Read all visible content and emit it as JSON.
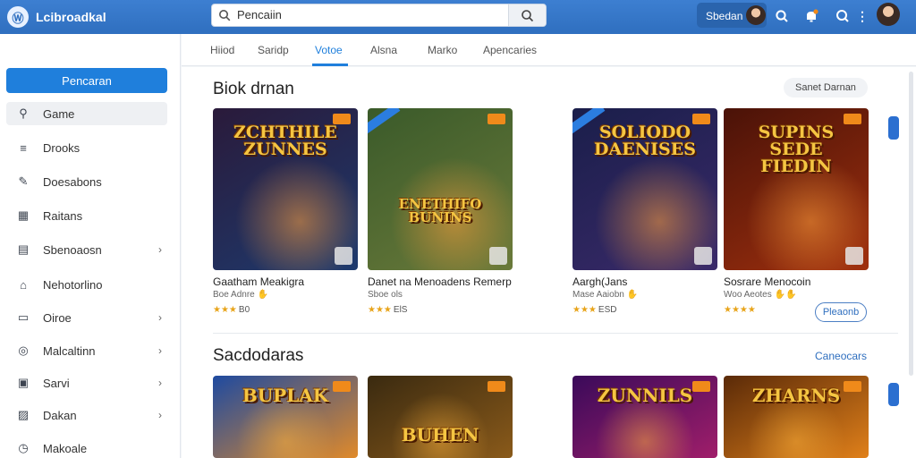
{
  "app": {
    "brand": "Lcibroadkal",
    "logo_glyph": "Ⓦ"
  },
  "search": {
    "value": "Pencaiin"
  },
  "header": {
    "user_label": "Sbedan"
  },
  "sidebar": {
    "primary_button": "Pencaran",
    "items": [
      {
        "label": "Game",
        "icon": "search-icon",
        "glyph": "⚲",
        "chevron": false,
        "active": true
      },
      {
        "label": "Drooks",
        "icon": "stack-icon",
        "glyph": "≡",
        "chevron": false,
        "active": false
      },
      {
        "label": "Doesabons",
        "icon": "pen-icon",
        "glyph": "✎",
        "chevron": false,
        "active": false
      },
      {
        "label": "Raitans",
        "icon": "calendar-icon",
        "glyph": "▦",
        "chevron": false,
        "active": false
      },
      {
        "label": "Sbenoaosn",
        "icon": "grid-icon",
        "glyph": "▤",
        "chevron": true,
        "active": false
      },
      {
        "label": "Nehotorlino",
        "icon": "home-icon",
        "glyph": "⌂",
        "chevron": false,
        "active": false
      },
      {
        "label": "Oiroe",
        "icon": "briefcase-icon",
        "glyph": "▭",
        "chevron": true,
        "active": false
      },
      {
        "label": "Malcaltinn",
        "icon": "globe-icon",
        "glyph": "◎",
        "chevron": true,
        "active": false
      },
      {
        "label": "Sarvi",
        "icon": "tablet-icon",
        "glyph": "▣",
        "chevron": true,
        "active": false
      },
      {
        "label": "Dakan",
        "icon": "image-icon",
        "glyph": "▨",
        "chevron": true,
        "active": false
      },
      {
        "label": "Makoale",
        "icon": "clock-icon",
        "glyph": "◷",
        "chevron": false,
        "active": false
      }
    ]
  },
  "tabs": [
    "Hiiod",
    "Saridp",
    "Votoe",
    "Alsna",
    "Marko",
    "Apencaries"
  ],
  "active_tab": "Votoe",
  "section1": {
    "title": "Biok drnan",
    "action": "Sanet Darnan",
    "cards": [
      {
        "art_title": "ZCHTHILE ZUNNES",
        "title": "Gaatham Meakigra",
        "subtitle": "Boe Adnre ✋",
        "stars": "★★★",
        "count": "B0",
        "colors": [
          "#2a1a3a",
          "#1e3a6e"
        ]
      },
      {
        "art_title": "ENETHIFO BUNINS",
        "title": "Danet na Menoadens Remerp",
        "subtitle": "Sboe ols",
        "stars": "★★★",
        "count": "ElS",
        "colors": [
          "#3a5a2a",
          "#6a7a3a"
        ]
      },
      {
        "art_title": "SOLIODO DAENISES",
        "title": "Aargh(Jans",
        "subtitle": "Mase Aaiobn ✋",
        "stars": "★★★",
        "count": "ESD",
        "colors": [
          "#1a1e4a",
          "#3a2a6a"
        ]
      },
      {
        "art_title": "SUPINS SEDE FIEDIN",
        "title": "Sosrare Menocoin",
        "subtitle": "Woo Aeotes ✋✋",
        "stars": "★★★★",
        "count": "",
        "colors": [
          "#4a1208",
          "#a0300e"
        ]
      }
    ],
    "card_button": "Pleaonb"
  },
  "section2": {
    "title": "Sacdodaras",
    "action": "Caneocars",
    "cards": [
      {
        "art_title": "BUPLAK",
        "colors": [
          "#1e4aa0",
          "#e08a2a"
        ]
      },
      {
        "art_title": "BUHEN",
        "colors": [
          "#3a2a10",
          "#8a5a1a"
        ]
      },
      {
        "art_title": "ZUNNILS",
        "colors": [
          "#3a0a5a",
          "#a01e6a"
        ]
      },
      {
        "art_title": "ZHARNS",
        "colors": [
          "#5a2a08",
          "#e0801a"
        ]
      }
    ]
  }
}
